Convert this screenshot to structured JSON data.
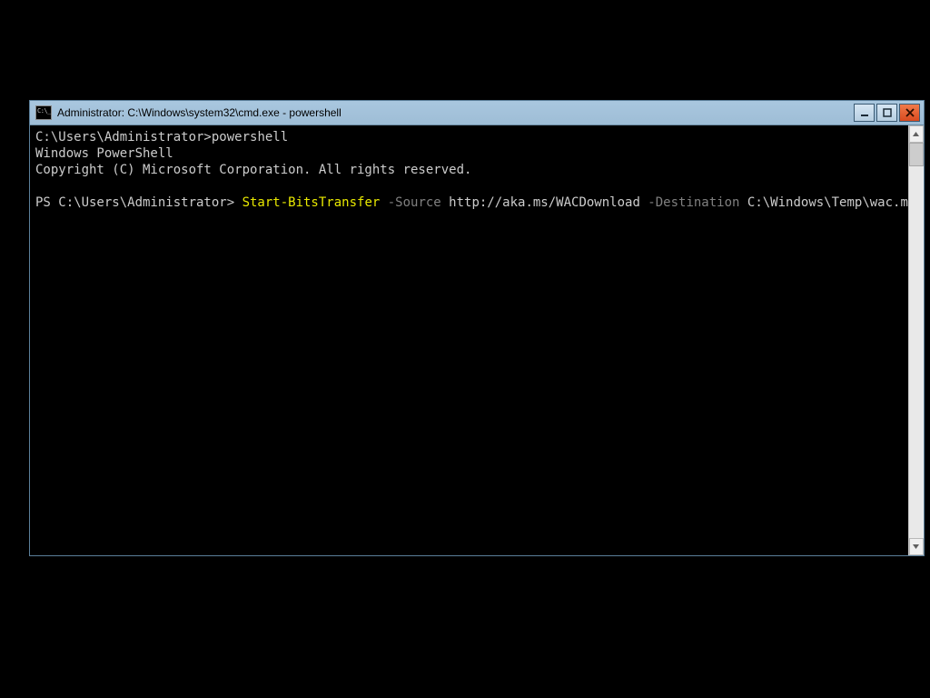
{
  "window": {
    "title": "Administrator: C:\\Windows\\system32\\cmd.exe - powershell"
  },
  "terminal": {
    "line1_prompt": "C:\\Users\\Administrator>",
    "line1_cmd": "powershell",
    "line2": "Windows PowerShell",
    "line3": "Copyright (C) Microsoft Corporation. All rights reserved.",
    "ps_prompt": "PS C:\\Users\\Administrator> ",
    "ps_cmd_cmdlet": "Start-BitsTransfer",
    "ps_cmd_param_source": " -Source ",
    "ps_cmd_url": "http://aka.ms/WACDownload",
    "ps_cmd_param_dest": " -Destination ",
    "ps_cmd_path": "C:\\Windows\\Temp\\wac.msi"
  }
}
